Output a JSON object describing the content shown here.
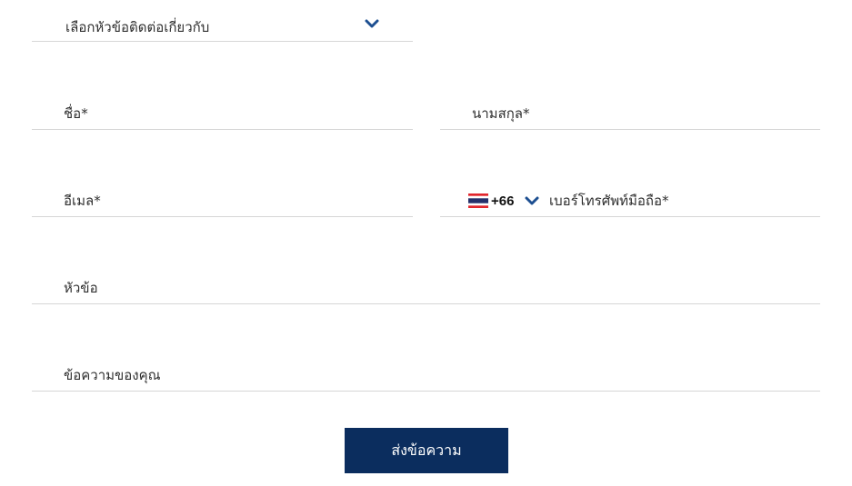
{
  "topic_select": {
    "placeholder": "เลือกหัวข้อติดต่อเกี่ยวกับ",
    "icon": "chevron-down-icon"
  },
  "fields": {
    "first_name": {
      "placeholder": "ชื่อ*",
      "value": ""
    },
    "last_name": {
      "placeholder": "นามสกุล*",
      "value": ""
    },
    "email": {
      "placeholder": "อีเมล*",
      "value": ""
    },
    "phone": {
      "country_flag": "thailand-flag-icon",
      "dial_code": "+66",
      "placeholder": "เบอร์โทรศัพท์มือถือ*",
      "value": ""
    },
    "subject": {
      "placeholder": "หัวข้อ",
      "value": ""
    },
    "message": {
      "placeholder": "ข้อความของคุณ",
      "value": ""
    }
  },
  "submit": {
    "label": "ส่งข้อความ"
  },
  "colors": {
    "accent": "#0b2d5e",
    "chevron": "#1d4f91",
    "underline": "#d6d6d6",
    "flag_red": "#e1262d",
    "flag_white": "#ffffff",
    "flag_blue": "#24306b"
  }
}
